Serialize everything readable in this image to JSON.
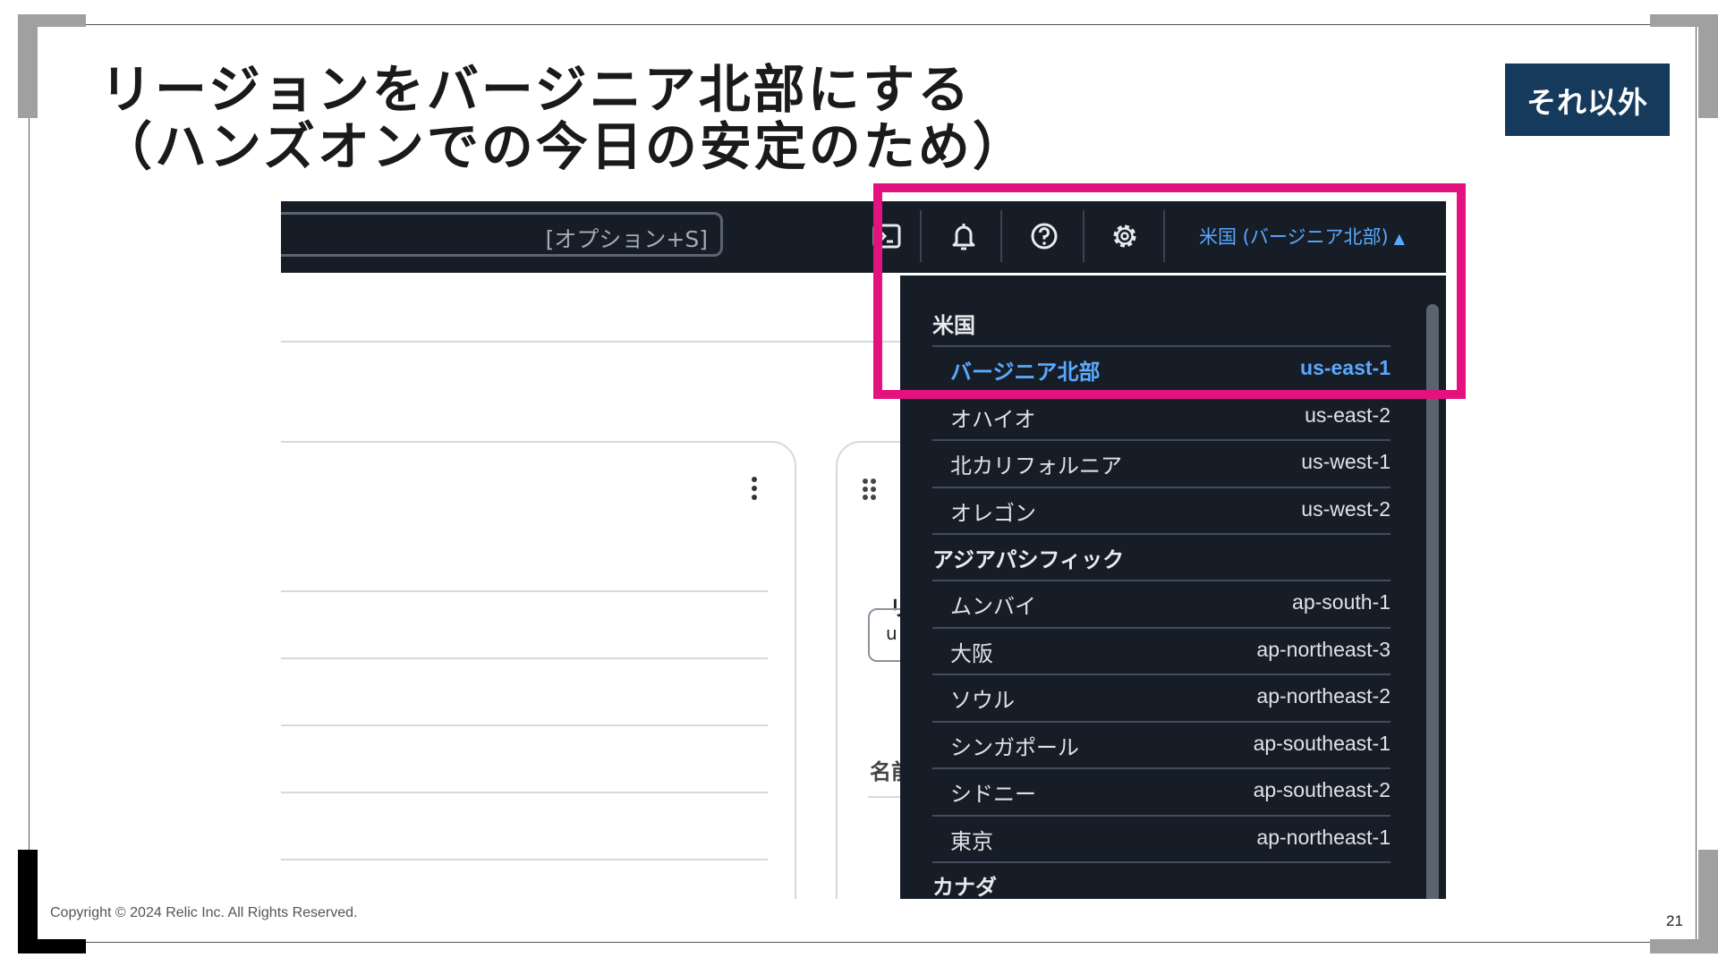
{
  "slide": {
    "title_line1": "リージョンをバージニア北部にする",
    "title_line2": "（ハンズオンでの今日の安定のため）",
    "badge": "それ以外",
    "copyright": "Copyright © 2024 Relic Inc. All Rights Reserved.",
    "page_number": "21",
    "highlight_color": "#e3127f",
    "badge_color": "#153a5c"
  },
  "console": {
    "search_shortcut": "[オプション+S]",
    "icons": [
      "cloudshell-icon",
      "bell-icon",
      "help-icon",
      "gear-icon"
    ],
    "region_button": "米国 (バージニア北部)",
    "region_caret": "▲",
    "accent_color": "#5aa8ff",
    "groups": [
      {
        "label": "米国",
        "regions": [
          {
            "name": "バージニア北部",
            "code": "us-east-1",
            "selected": true
          },
          {
            "name": "オハイオ",
            "code": "us-east-2"
          },
          {
            "name": "北カリフォルニア",
            "code": "us-west-1"
          },
          {
            "name": "オレゴン",
            "code": "us-west-2"
          }
        ]
      },
      {
        "label": "アジアパシフィック",
        "regions": [
          {
            "name": "ムンバイ",
            "code": "ap-south-1"
          },
          {
            "name": "大阪",
            "code": "ap-northeast-3"
          },
          {
            "name": "ソウル",
            "code": "ap-northeast-2"
          },
          {
            "name": "シンガポール",
            "code": "ap-southeast-1"
          },
          {
            "name": "シドニー",
            "code": "ap-southeast-2"
          },
          {
            "name": "東京",
            "code": "ap-northeast-1"
          }
        ]
      },
      {
        "label": "カナダ",
        "regions": []
      }
    ],
    "background_text": {
      "card_heading_fragment": "リ",
      "input_fragment": "u",
      "name_label_fragment": "名前"
    }
  }
}
